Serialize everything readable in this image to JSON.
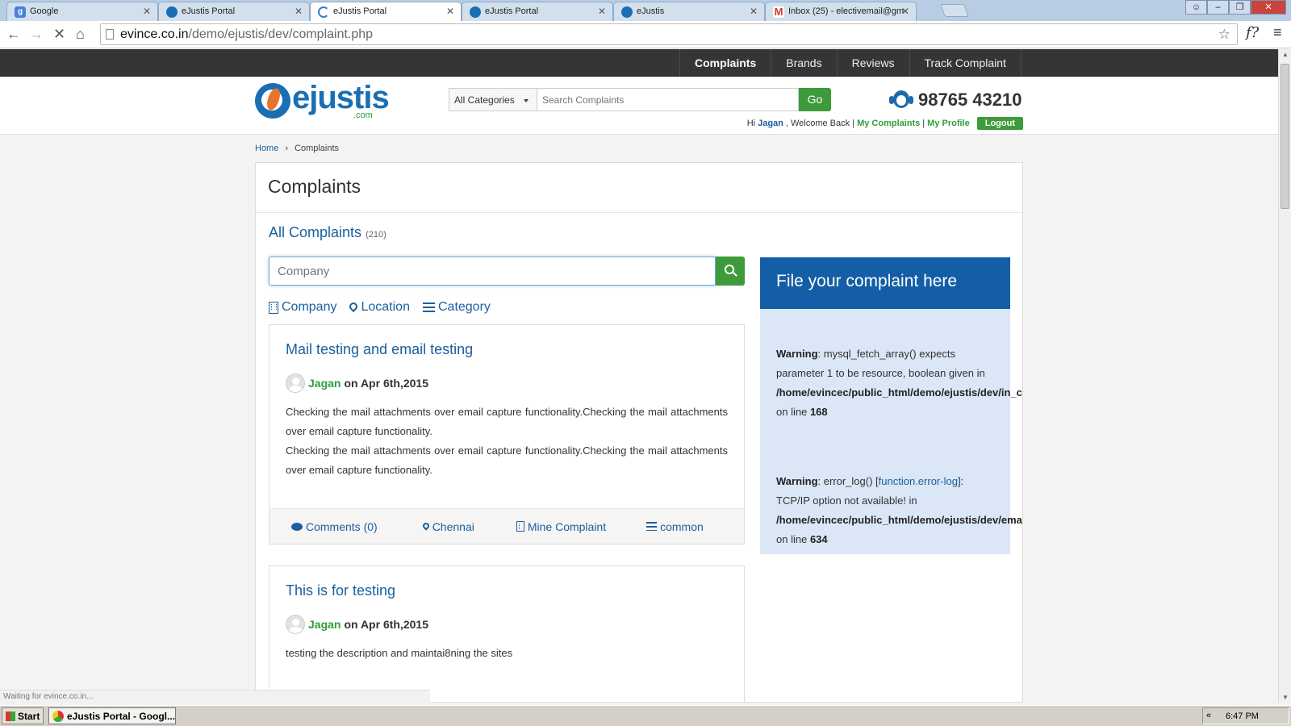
{
  "browser": {
    "tabs": [
      {
        "title": "Google",
        "favicon": "google-icon",
        "color": "#4a7fe0"
      },
      {
        "title": "eJustis Portal",
        "favicon": "ejustis-icon",
        "color": "#1a6fb3"
      },
      {
        "title": "eJustis Portal",
        "favicon": "loading-spinner-icon",
        "color": "#1a6fb3",
        "active": true
      },
      {
        "title": "eJustis Portal",
        "favicon": "ejustis-icon",
        "color": "#1a6fb3"
      },
      {
        "title": "eJustis",
        "favicon": "ejustis-icon",
        "color": "#1a6fb3"
      },
      {
        "title": "Inbox (25) - electivemail@gm",
        "favicon": "gmail-icon",
        "color": "#d33b2c"
      }
    ],
    "url_host": "evince.co.in",
    "url_path": "/demo/ejustis/dev/complaint.php",
    "status": "Waiting for evince.co.in..."
  },
  "site": {
    "nav": [
      "Complaints",
      "Brands",
      "Reviews",
      "Track Complaint"
    ],
    "logo_text": "ejustis",
    "logo_suffix": ".com",
    "search": {
      "category": "All Categories",
      "placeholder": "Search Complaints",
      "go": "Go"
    },
    "phone": "98765 43210",
    "user": {
      "hi": "Hi",
      "name": "Jagan",
      "welcome": ", Welcome Back |",
      "my_complaints": "My Complaints",
      "sep": "|",
      "my_profile": "My Profile",
      "logout": "Logout"
    }
  },
  "breadcrumb": {
    "home": "Home",
    "separator": "›",
    "current": "Complaints"
  },
  "main": {
    "title": "Complaints",
    "all_complaints": "All Complaints",
    "count": "(210)",
    "search_placeholder": "Company",
    "filters": [
      "Company",
      "Location",
      "Category"
    ],
    "complaints": [
      {
        "title": "Mail testing and email testing",
        "author": "Jagan",
        "date": "on Apr 6th,2015",
        "body1": "Checking the mail attachments over email capture functionality.Checking the mail attachments over email capture functionality.",
        "body2": "Checking the mail attachments over email capture functionality.Checking the mail attachments over email capture functionality.",
        "comments": "Comments (0)",
        "location": "Chennai",
        "company": "Mine Complaint",
        "category": "common"
      },
      {
        "title": "This is for testing",
        "author": "Jagan",
        "date": "on Apr 6th,2015",
        "body1": "testing the description and maintai8ning the sites"
      }
    ]
  },
  "sidebar": {
    "heading": "File your complaint here",
    "warning1": {
      "label": "Warning",
      "text": ": mysql_fetch_array() expects parameter 1 to be resource, boolean given in",
      "path": "/home/evincec/public_html/demo/ejustis/dev/in_cform.php",
      "online": "on line",
      "line": "168"
    },
    "warning2": {
      "label": "Warning",
      "text_a": ": error_log() [",
      "link": "function.error-log",
      "text_b": "]: TCP/IP option not available! in",
      "path": "/home/evincec/public_html/demo/ejustis/dev/emails/class.phpmailer.php",
      "online": "on line",
      "line": "634"
    }
  },
  "taskbar": {
    "start": "Start",
    "window": "eJustis Portal - Googl...",
    "tray_chevron": "«",
    "time": "6:47 PM"
  },
  "colors": {
    "brand_blue": "#1a5fa0",
    "brand_green": "#3e9b3c",
    "nav_dark": "#353535",
    "sidebox_blue": "#135ea6"
  }
}
